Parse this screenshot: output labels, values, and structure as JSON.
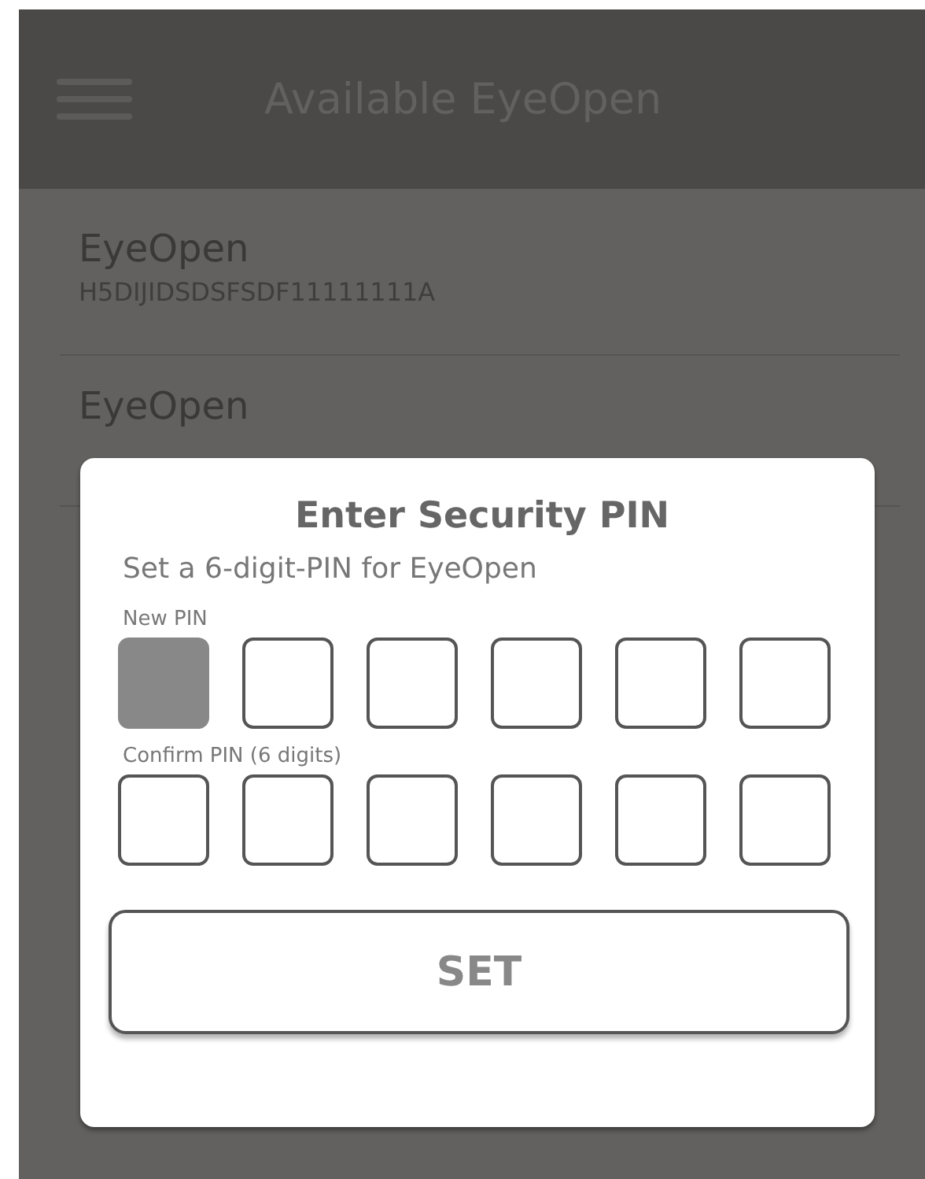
{
  "app_bar": {
    "title": "Available EyeOpen"
  },
  "devices": [
    {
      "name": "EyeOpen",
      "serial": "H5DIJIDSDSFSDF11111111A"
    },
    {
      "name": "EyeOpen"
    }
  ],
  "dialog": {
    "title": "Enter Security PIN",
    "subtitle": "Set a 6-digit-PIN for EyeOpen",
    "fields": [
      {
        "label": "New PIN",
        "cells": [
          {
            "active": true
          },
          {
            "active": false
          },
          {
            "active": false
          },
          {
            "active": false
          },
          {
            "active": false
          },
          {
            "active": false
          }
        ]
      },
      {
        "label": "Confirm PIN (6 digits)",
        "cells": [
          {
            "active": false
          },
          {
            "active": false
          },
          {
            "active": false
          },
          {
            "active": false
          },
          {
            "active": false
          },
          {
            "active": false
          }
        ]
      }
    ],
    "button": "SET"
  }
}
